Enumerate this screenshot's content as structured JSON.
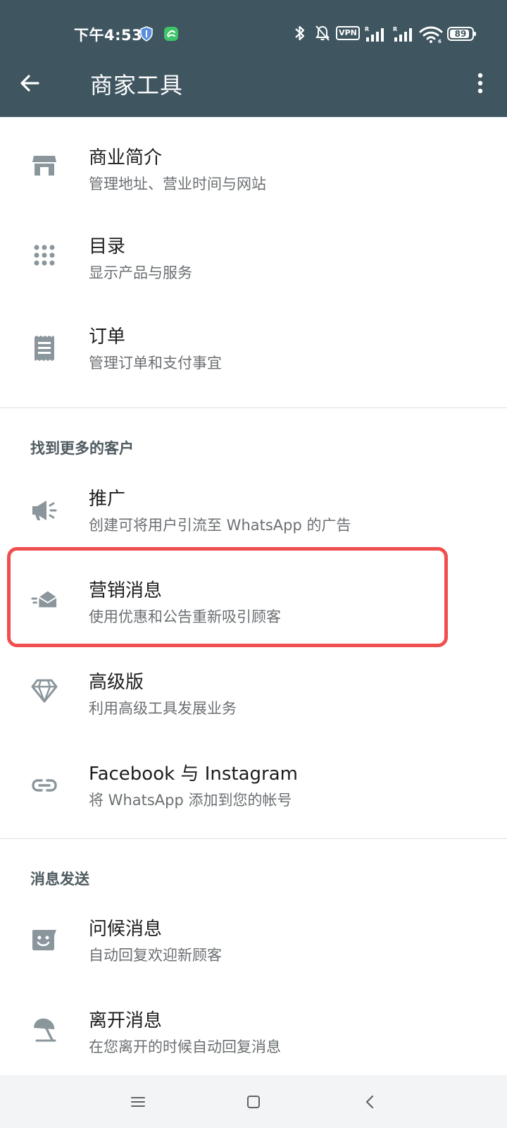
{
  "status_bar": {
    "time": "下午4:53",
    "vpn_label": "VPN",
    "battery_percent": 89
  },
  "app_bar": {
    "title": "商家工具"
  },
  "items": {
    "business_profile": {
      "title": "商业简介",
      "subtitle": "管理地址、营业时间与网站",
      "icon": "store-icon"
    },
    "catalog": {
      "title": "目录",
      "subtitle": "显示产品与服务",
      "icon": "grid-icon"
    },
    "orders": {
      "title": "订单",
      "subtitle": "管理订单和支付事宜",
      "icon": "receipt-icon"
    },
    "promote": {
      "title": "推广",
      "subtitle": "创建可将用户引流至 WhatsApp 的广告",
      "icon": "megaphone-icon"
    },
    "marketing": {
      "title": "营销消息",
      "subtitle": "使用优惠和公告重新吸引顾客",
      "icon": "envelope-icon"
    },
    "premium": {
      "title": "高级版",
      "subtitle": "利用高级工具发展业务",
      "icon": "diamond-icon"
    },
    "facebook": {
      "title": "Facebook 与 Instagram",
      "subtitle": "将 WhatsApp 添加到您的帐号",
      "icon": "link-icon"
    },
    "greeting": {
      "title": "问候消息",
      "subtitle": "自动回复欢迎新顾客",
      "icon": "smile-chat-icon"
    },
    "away": {
      "title": "离开消息",
      "subtitle": "在您离开的时候自动回复消息",
      "icon": "umbrella-icon"
    }
  },
  "sections": {
    "find_customers": "找到更多的客户",
    "messaging": "消息发送"
  },
  "colors": {
    "header_bg": "#3f5661",
    "icon_gray": "#8a969c",
    "highlight_red": "#f04f4f"
  }
}
